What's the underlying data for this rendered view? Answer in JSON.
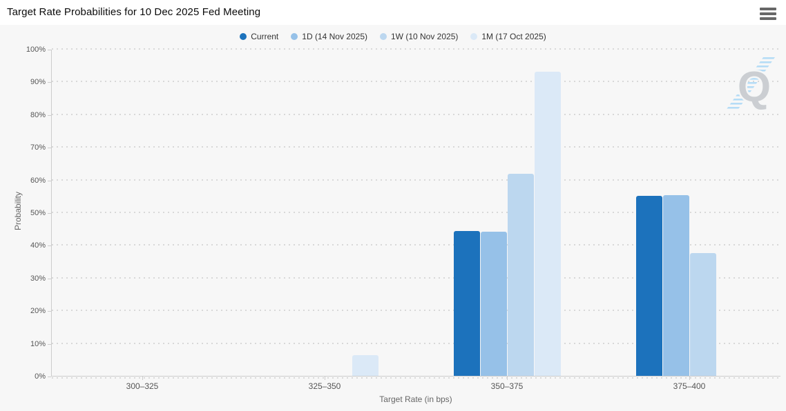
{
  "header": {
    "title": "Target Rate Probabilities for 10 Dec 2025 Fed Meeting",
    "menu_icon": "hamburger-menu-icon"
  },
  "watermark": {
    "letter": "Q"
  },
  "colors": {
    "page_bg": "#f7f7f7",
    "titlebar_bg": "#ffffff",
    "axis_line": "#cccccc",
    "gridline": "#d8d8d8",
    "menu_icon": "#676767",
    "watermark_letter": "#cbced2",
    "watermark_stripes": "#b5dcf6"
  },
  "chart_data": {
    "type": "bar",
    "title": "Target Rate Probabilities for 10 Dec 2025 Fed Meeting",
    "xlabel": "Target Rate (in bps)",
    "ylabel": "Probability",
    "ylim": [
      0,
      100
    ],
    "ytick_step": 10,
    "ytick_suffix": "%",
    "grid": "dotted-horizontal",
    "legend_position": "top-center",
    "categories": [
      "300–325",
      "325–350",
      "350–375",
      "375–400"
    ],
    "series": [
      {
        "name": "Current",
        "color": "#1c72bc",
        "values": [
          null,
          null,
          44.5,
          55.1
        ]
      },
      {
        "name": "1D (14 Nov 2025)",
        "color": "#96c1e8",
        "values": [
          null,
          null,
          44.2,
          55.5
        ]
      },
      {
        "name": "1W (10 Nov 2025)",
        "color": "#bcd7ef",
        "values": [
          null,
          null,
          62.0,
          37.6
        ]
      },
      {
        "name": "1M (17 Oct 2025)",
        "color": "#dbe9f7",
        "values": [
          null,
          6.3,
          93.3,
          null
        ]
      }
    ]
  }
}
